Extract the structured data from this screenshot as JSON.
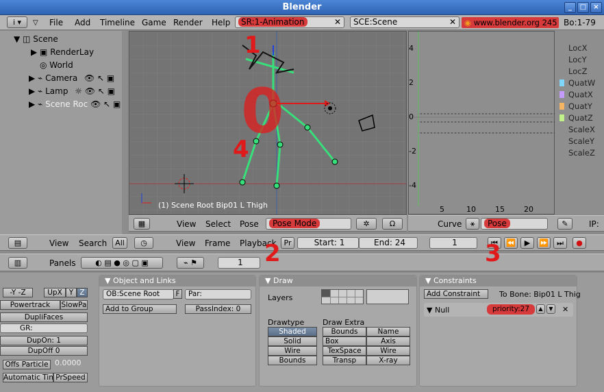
{
  "window": {
    "title": "Blender"
  },
  "menu": {
    "items": [
      "File",
      "Add",
      "Timeline",
      "Game",
      "Render",
      "Help"
    ],
    "screen_field": "SR:1-Animation",
    "scene_field": "SCE:Scene",
    "url": "www.blender.org 245",
    "stats": "Bo:1-79"
  },
  "outliner": {
    "items": [
      "Scene",
      "RenderLay",
      "World",
      "Camera",
      "Lamp",
      "Scene Roc"
    ]
  },
  "view3d": {
    "status": "(1) Scene Root Bip01 L Thigh",
    "header": {
      "view": "View",
      "select": "Select",
      "pose": "Pose",
      "mode": "Pose Mode"
    }
  },
  "ipo": {
    "y_ticks": [
      "4",
      "2",
      "0",
      "-2",
      "-4"
    ],
    "x_ticks": [
      "5",
      "10",
      "15",
      "20"
    ],
    "channels": [
      {
        "name": "LocX",
        "color": ""
      },
      {
        "name": "LocY",
        "color": ""
      },
      {
        "name": "LocZ",
        "color": ""
      },
      {
        "name": "QuatW",
        "color": "#7fd7ff"
      },
      {
        "name": "QuatX",
        "color": "#c49aff"
      },
      {
        "name": "QuatY",
        "color": "#f5b563"
      },
      {
        "name": "QuatZ",
        "color": "#bff08a"
      },
      {
        "name": "ScaleX",
        "color": ""
      },
      {
        "name": "ScaleY",
        "color": ""
      },
      {
        "name": "ScaleZ",
        "color": ""
      }
    ],
    "header": {
      "curve": "Curve",
      "pose": "Pose",
      "ip": "IP:"
    }
  },
  "outliner_header": {
    "view": "View",
    "search": "Search",
    "all": "All"
  },
  "timeline": {
    "view": "View",
    "frame": "Frame",
    "playback": "Playback",
    "pr": "Pr",
    "start": "Start: 1",
    "end": "End: 24",
    "current": "1"
  },
  "buttons_header": {
    "panels": "Panels",
    "value": "1"
  },
  "left_panel": {
    "axes": [
      "-Y",
      "-Z",
      "UpX",
      "Y",
      "Z"
    ],
    "powertrack": "Powertrack",
    "slowpa": "SlowPa",
    "dupliframes": "DupliFaces",
    "gr": "GR:",
    "dupon": "DupOn: 1",
    "dupoff": "DupOff 0",
    "offs": "Offs Particle",
    "offs_val": "0.0000",
    "autotime": "Automatic Time",
    "prspeed": "PrSpeed"
  },
  "object_links": {
    "title": "Object and Links",
    "ob": "OB:Scene Root",
    "f": "F",
    "par": "Par:",
    "add_group": "Add to Group",
    "passindex": "PassIndex: 0"
  },
  "draw": {
    "title": "Draw",
    "layers": "Layers",
    "drawtype": "Drawtype",
    "drawextra": "Draw Extra",
    "types": [
      "Shaded",
      "Solid",
      "Wire",
      "Bounds"
    ],
    "extra": [
      "Bounds",
      "Name",
      "Box",
      "Axis",
      "TexSpace",
      "Wire",
      "Transp",
      "X-ray"
    ]
  },
  "constraints": {
    "title": "Constraints",
    "add": "Add Constraint",
    "to_bone": "To Bone: Bip01 L Thig",
    "null": "Null",
    "priority": "priority:27",
    "x": "✕"
  },
  "annotations": [
    "1",
    "0",
    "4",
    "2",
    "3"
  ],
  "colors": {
    "accent": "#d63a3a",
    "bone": "#37e07a",
    "grid": "#747474"
  }
}
